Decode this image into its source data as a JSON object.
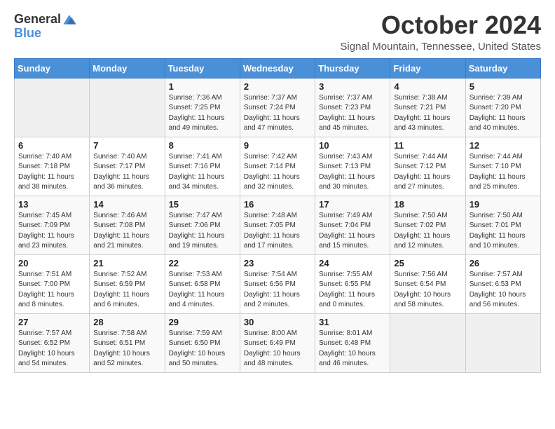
{
  "header": {
    "logo_general": "General",
    "logo_blue": "Blue",
    "month": "October 2024",
    "location": "Signal Mountain, Tennessee, United States"
  },
  "days_of_week": [
    "Sunday",
    "Monday",
    "Tuesday",
    "Wednesday",
    "Thursday",
    "Friday",
    "Saturday"
  ],
  "weeks": [
    [
      {
        "day": "",
        "info": ""
      },
      {
        "day": "",
        "info": ""
      },
      {
        "day": "1",
        "info": "Sunrise: 7:36 AM\nSunset: 7:25 PM\nDaylight: 11 hours and 49 minutes."
      },
      {
        "day": "2",
        "info": "Sunrise: 7:37 AM\nSunset: 7:24 PM\nDaylight: 11 hours and 47 minutes."
      },
      {
        "day": "3",
        "info": "Sunrise: 7:37 AM\nSunset: 7:23 PM\nDaylight: 11 hours and 45 minutes."
      },
      {
        "day": "4",
        "info": "Sunrise: 7:38 AM\nSunset: 7:21 PM\nDaylight: 11 hours and 43 minutes."
      },
      {
        "day": "5",
        "info": "Sunrise: 7:39 AM\nSunset: 7:20 PM\nDaylight: 11 hours and 40 minutes."
      }
    ],
    [
      {
        "day": "6",
        "info": "Sunrise: 7:40 AM\nSunset: 7:18 PM\nDaylight: 11 hours and 38 minutes."
      },
      {
        "day": "7",
        "info": "Sunrise: 7:40 AM\nSunset: 7:17 PM\nDaylight: 11 hours and 36 minutes."
      },
      {
        "day": "8",
        "info": "Sunrise: 7:41 AM\nSunset: 7:16 PM\nDaylight: 11 hours and 34 minutes."
      },
      {
        "day": "9",
        "info": "Sunrise: 7:42 AM\nSunset: 7:14 PM\nDaylight: 11 hours and 32 minutes."
      },
      {
        "day": "10",
        "info": "Sunrise: 7:43 AM\nSunset: 7:13 PM\nDaylight: 11 hours and 30 minutes."
      },
      {
        "day": "11",
        "info": "Sunrise: 7:44 AM\nSunset: 7:12 PM\nDaylight: 11 hours and 27 minutes."
      },
      {
        "day": "12",
        "info": "Sunrise: 7:44 AM\nSunset: 7:10 PM\nDaylight: 11 hours and 25 minutes."
      }
    ],
    [
      {
        "day": "13",
        "info": "Sunrise: 7:45 AM\nSunset: 7:09 PM\nDaylight: 11 hours and 23 minutes."
      },
      {
        "day": "14",
        "info": "Sunrise: 7:46 AM\nSunset: 7:08 PM\nDaylight: 11 hours and 21 minutes."
      },
      {
        "day": "15",
        "info": "Sunrise: 7:47 AM\nSunset: 7:06 PM\nDaylight: 11 hours and 19 minutes."
      },
      {
        "day": "16",
        "info": "Sunrise: 7:48 AM\nSunset: 7:05 PM\nDaylight: 11 hours and 17 minutes."
      },
      {
        "day": "17",
        "info": "Sunrise: 7:49 AM\nSunset: 7:04 PM\nDaylight: 11 hours and 15 minutes."
      },
      {
        "day": "18",
        "info": "Sunrise: 7:50 AM\nSunset: 7:02 PM\nDaylight: 11 hours and 12 minutes."
      },
      {
        "day": "19",
        "info": "Sunrise: 7:50 AM\nSunset: 7:01 PM\nDaylight: 11 hours and 10 minutes."
      }
    ],
    [
      {
        "day": "20",
        "info": "Sunrise: 7:51 AM\nSunset: 7:00 PM\nDaylight: 11 hours and 8 minutes."
      },
      {
        "day": "21",
        "info": "Sunrise: 7:52 AM\nSunset: 6:59 PM\nDaylight: 11 hours and 6 minutes."
      },
      {
        "day": "22",
        "info": "Sunrise: 7:53 AM\nSunset: 6:58 PM\nDaylight: 11 hours and 4 minutes."
      },
      {
        "day": "23",
        "info": "Sunrise: 7:54 AM\nSunset: 6:56 PM\nDaylight: 11 hours and 2 minutes."
      },
      {
        "day": "24",
        "info": "Sunrise: 7:55 AM\nSunset: 6:55 PM\nDaylight: 11 hours and 0 minutes."
      },
      {
        "day": "25",
        "info": "Sunrise: 7:56 AM\nSunset: 6:54 PM\nDaylight: 10 hours and 58 minutes."
      },
      {
        "day": "26",
        "info": "Sunrise: 7:57 AM\nSunset: 6:53 PM\nDaylight: 10 hours and 56 minutes."
      }
    ],
    [
      {
        "day": "27",
        "info": "Sunrise: 7:57 AM\nSunset: 6:52 PM\nDaylight: 10 hours and 54 minutes."
      },
      {
        "day": "28",
        "info": "Sunrise: 7:58 AM\nSunset: 6:51 PM\nDaylight: 10 hours and 52 minutes."
      },
      {
        "day": "29",
        "info": "Sunrise: 7:59 AM\nSunset: 6:50 PM\nDaylight: 10 hours and 50 minutes."
      },
      {
        "day": "30",
        "info": "Sunrise: 8:00 AM\nSunset: 6:49 PM\nDaylight: 10 hours and 48 minutes."
      },
      {
        "day": "31",
        "info": "Sunrise: 8:01 AM\nSunset: 6:48 PM\nDaylight: 10 hours and 46 minutes."
      },
      {
        "day": "",
        "info": ""
      },
      {
        "day": "",
        "info": ""
      }
    ]
  ],
  "colors": {
    "header_bg": "#4a90d9",
    "accent": "#4a90d9"
  }
}
